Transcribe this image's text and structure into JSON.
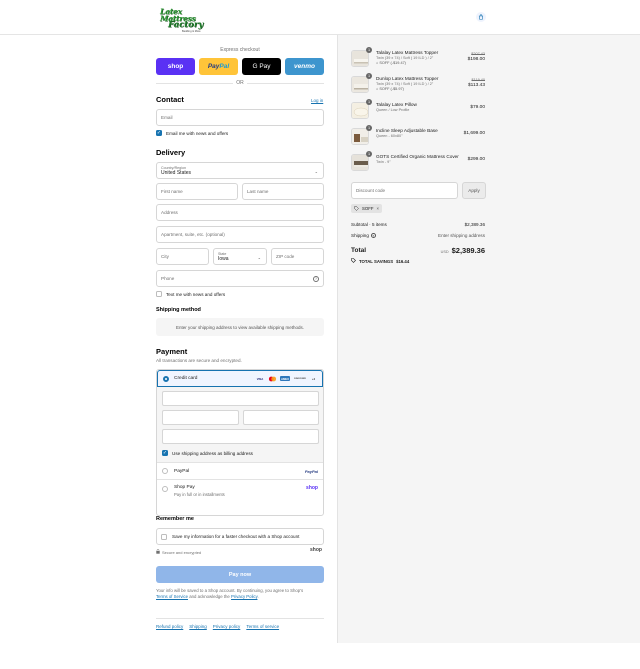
{
  "brand": {
    "line1": "Latex Mattress",
    "line2": "Factory",
    "tagline": "Bedding & More"
  },
  "express": {
    "title": "Express checkout",
    "or": "OR",
    "shop": "shop",
    "paypal_a": "Pay",
    "paypal_b": "Pal",
    "gpay": "G Pay",
    "venmo": "venmo"
  },
  "contact": {
    "heading": "Contact",
    "login": "Log in",
    "email_placeholder": "Email",
    "email_news": "Email me with news and offers"
  },
  "delivery": {
    "heading": "Delivery",
    "country_label": "Country/Region",
    "country_value": "United States",
    "first_name": "First name",
    "last_name": "Last name",
    "address": "Address",
    "apartment": "Apartment, suite, etc. (optional)",
    "city": "City",
    "state_label": "State",
    "state_value": "Iowa",
    "zip": "ZIP code",
    "phone": "Phone",
    "text_news": "Text me with news and offers"
  },
  "shipping_method": {
    "heading": "Shipping method",
    "placeholder": "Enter your shipping address to view available shipping methods."
  },
  "payment": {
    "heading": "Payment",
    "subtitle": "All transactions are secure and encrypted.",
    "credit_card": "Credit card",
    "cards": [
      "VISA",
      "MC",
      "AMEX",
      "DISCOVER",
      "+4"
    ],
    "billing": "Use shipping address as billing address",
    "paypal": "PayPal",
    "paypal_logo": "PayPal",
    "shop_pay": "Shop Pay",
    "shop_pay_sub": "Pay in full or in installments",
    "shop_logo": "shop"
  },
  "remember": {
    "heading": "Remember me",
    "save_info": "Save my information for a faster checkout with a Shop account",
    "secure": "Secure and encrypted",
    "shop_logo": "shop"
  },
  "pay_now": "Pay now",
  "legal": {
    "text1": "Your info will be saved to a Shop account. By continuing, you agree to Shop's",
    "terms": "Terms of Service",
    "and": "and acknowledge the",
    "privacy": "Privacy Policy",
    "period": "."
  },
  "footer": [
    "Refund policy",
    "Shipping",
    "Privacy policy",
    "Terms of service"
  ],
  "cart": {
    "items": [
      {
        "qty": "1",
        "name": "Talalay Latex Mattress Topper",
        "variant": "Twin (39 x 74) / Soft ( 19 ILD ) / 2\"",
        "discount": "SOFF (-$19.47)",
        "old_price": "$207.43",
        "price": "$198.00"
      },
      {
        "qty": "1",
        "name": "Dunlop Latex Mattress Topper",
        "variant": "Twin (39 x 74) / Soft ( 19 ILD ) / 2\"",
        "discount": "SOFF (-$5.97)",
        "old_price": "$119.40",
        "price": "$113.43"
      },
      {
        "qty": "1",
        "name": "Talalay Latex Pillow",
        "variant": "Queen / Low Profile",
        "discount": "",
        "old_price": "",
        "price": "$79.00"
      },
      {
        "qty": "1",
        "name": "Incline Sleep Adjustable Base",
        "variant": "Queen - 60x80\"",
        "discount": "",
        "old_price": "",
        "price": "$1,699.00"
      },
      {
        "qty": "1",
        "name": "GOTS Certified Organic Mattress Cover",
        "variant": "Twin - 9\"",
        "discount": "",
        "old_price": "",
        "price": "$299.00"
      }
    ],
    "discount_placeholder": "Discount code",
    "apply": "Apply",
    "code_tag": "SOFF",
    "subtotal_label": "Subtotal · 5 items",
    "subtotal": "$2,389.36",
    "shipping_label": "Shipping",
    "shipping_value": "Enter shipping address",
    "total_label": "Total",
    "currency": "USD",
    "total": "$2,389.36",
    "savings_label": "TOTAL SAVINGS",
    "savings": "$16.44"
  },
  "colors": {
    "accent": "#1773b0",
    "shop": "#5a31f4",
    "paypal": "#ffc439",
    "venmo": "#3d95ce",
    "pay_now_disabled": "#90b6e9"
  }
}
